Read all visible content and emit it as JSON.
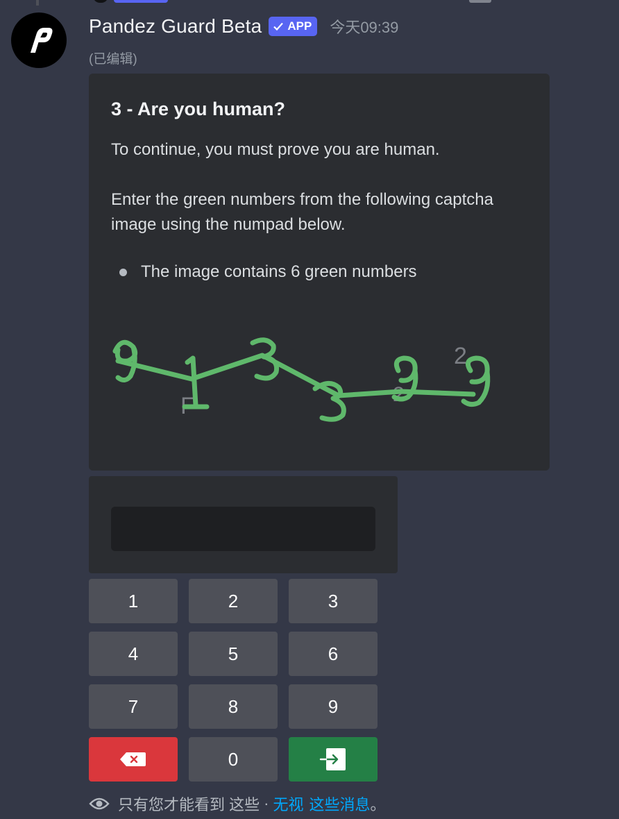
{
  "message": {
    "username": "Pandez Guard Beta",
    "app_badge": "APP",
    "timestamp": "今天09:39",
    "edited": "(已编辑)"
  },
  "embed": {
    "title": "3 - Are you human?",
    "description_line1": "To continue, you must prove you are human.",
    "description_line2": "Enter the green numbers from the following captcha image using the numpad below.",
    "bullet": "The image contains 6 green numbers",
    "captcha_colors": {
      "green": "#5fb86b",
      "gray": "#8a8d93"
    }
  },
  "numpad": {
    "keys": [
      "1",
      "2",
      "3",
      "4",
      "5",
      "6",
      "7",
      "8",
      "9",
      "0"
    ],
    "delete_icon": "backspace-icon",
    "submit_icon": "enter-icon",
    "colors": {
      "default": "#4e5058",
      "delete": "#da373c",
      "submit": "#248046"
    }
  },
  "footer": {
    "text": "只有您才能看到 这些",
    "separator": "·",
    "dismiss_link1": "无视",
    "dismiss_link2": "这些消息",
    "period": "。"
  }
}
